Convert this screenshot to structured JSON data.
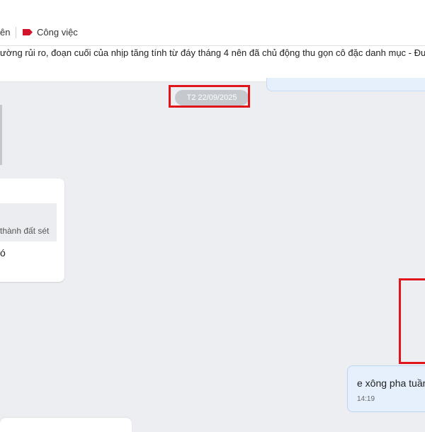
{
  "header": {
    "tag_partial": "ên",
    "tag_work": "Công việc",
    "tag_work_icon": "label-tag-icon",
    "tag_color": "#d0142a"
  },
  "pinned": {
    "text": "ường rủi ro, đoạn cuối của nhịp tăng tính từ đáy tháng 4 nên đã chủ động thu gọn cô đặc danh mục - Đưa tàu"
  },
  "chat": {
    "date_separator": "T2 22/09/2025",
    "received": {
      "quote_text": "thành đất sét",
      "text": "ó"
    },
    "sent": {
      "text": "e xông pha tuần",
      "time": "14:19"
    }
  },
  "colors": {
    "highlight": "#e0141b",
    "sent_bubble": "#e6f0fd",
    "background": "#eceef1"
  }
}
